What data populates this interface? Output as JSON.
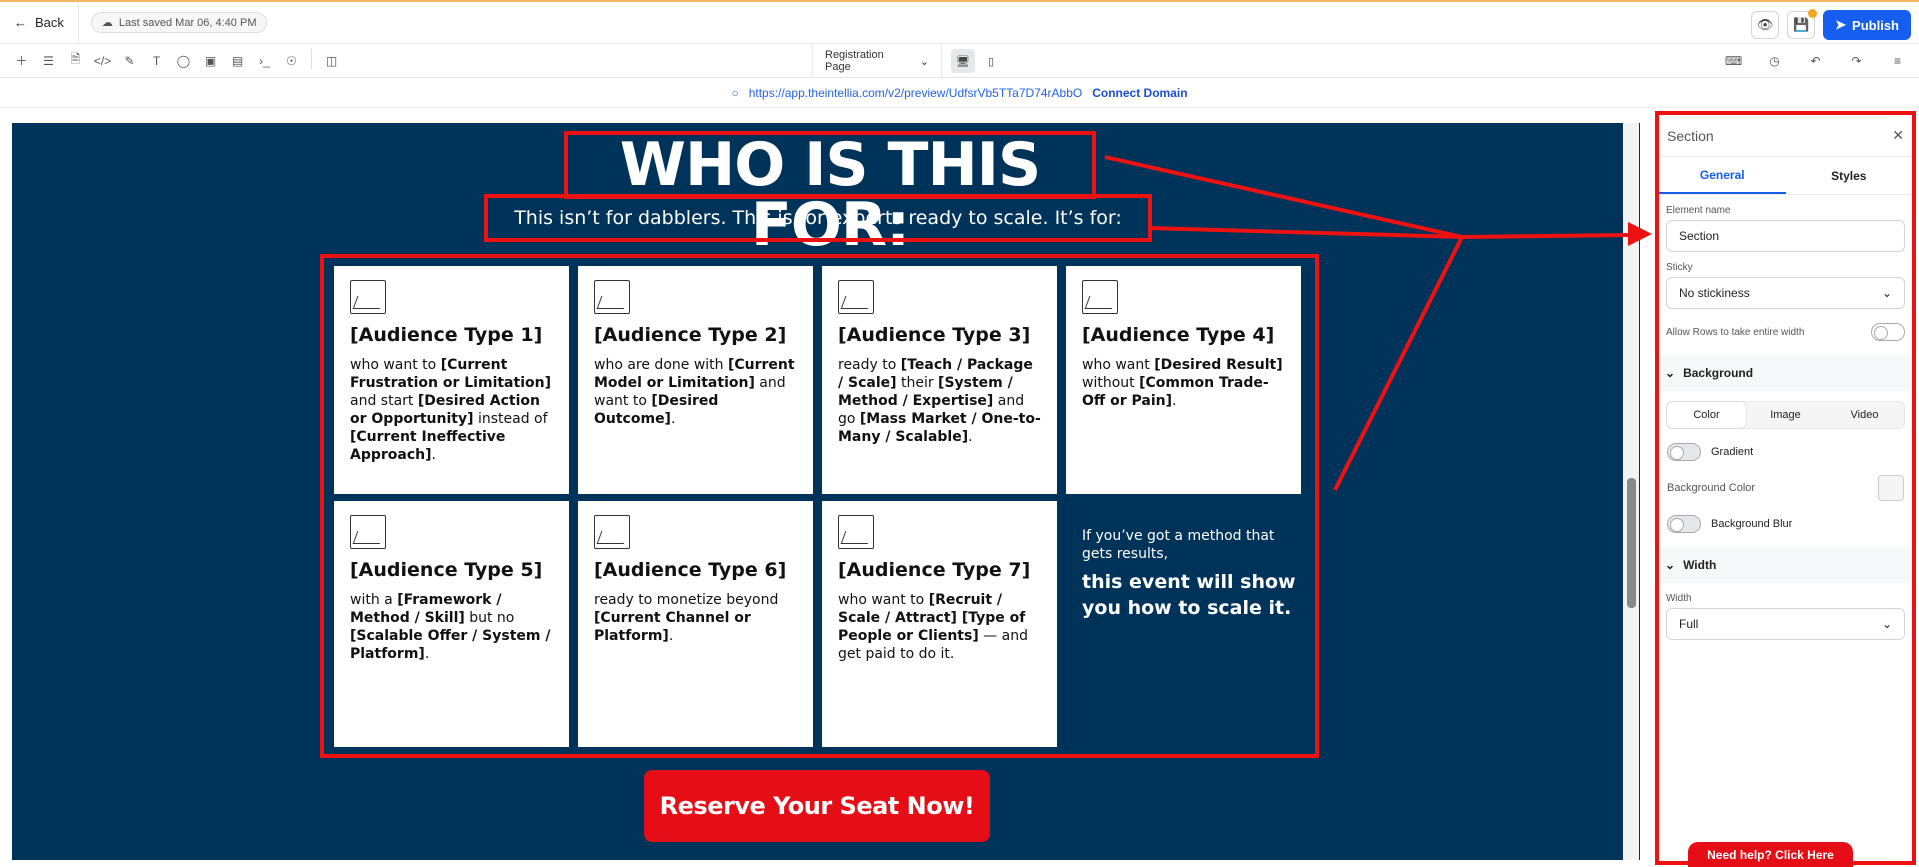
{
  "topbar": {
    "back_label": "Back",
    "saved_label": "Last saved Mar 06, 4:40 PM",
    "publish_label": "Publish"
  },
  "toolbar": {
    "page_name": "Registration Page"
  },
  "urlbar": {
    "url": "https://app.theintellia.com/v2/preview/UdfsrVb5TTa7D74rAbbO",
    "connect_label": "Connect Domain"
  },
  "canvas": {
    "title": "WHO IS THIS FOR:",
    "subtitle": "This isn’t for dabblers. This is for experts ready to scale. It’s for:",
    "cards": [
      {
        "title": "[Audience Type 1]",
        "parts": [
          [
            "who want to ",
            false
          ],
          [
            "[Current Frustration or Limitation]",
            true
          ],
          [
            " and start ",
            false
          ],
          [
            "[Desired Action or Opportunity]",
            true
          ],
          [
            " instead of ",
            false
          ],
          [
            "[Current Ineffective Approach]",
            true
          ],
          [
            ".",
            false
          ]
        ]
      },
      {
        "title": "[Audience Type 2]",
        "parts": [
          [
            "who are done with ",
            false
          ],
          [
            "[Current Model or Limitation]",
            true
          ],
          [
            " and want to ",
            false
          ],
          [
            "[Desired Outcome]",
            true
          ],
          [
            ".",
            false
          ]
        ]
      },
      {
        "title": "[Audience Type 3]",
        "parts": [
          [
            "ready to ",
            false
          ],
          [
            "[Teach / Package / Scale]",
            true
          ],
          [
            " their ",
            false
          ],
          [
            "[System / Method / Expertise]",
            true
          ],
          [
            " and go ",
            false
          ],
          [
            "[Mass Market / One-to-Many / Scalable]",
            true
          ],
          [
            ".",
            false
          ]
        ]
      },
      {
        "title": "[Audience Type 4]",
        "parts": [
          [
            "who want ",
            false
          ],
          [
            "[Desired Result]",
            true
          ],
          [
            " without ",
            false
          ],
          [
            "[Common Trade-Off or Pain]",
            true
          ],
          [
            ".",
            false
          ]
        ]
      },
      {
        "title": "[Audience Type 5]",
        "parts": [
          [
            "with a ",
            false
          ],
          [
            "[Framework / Method / Skill]",
            true
          ],
          [
            " but no ",
            false
          ],
          [
            "[Scalable Offer / System / Platform]",
            true
          ],
          [
            ".",
            false
          ]
        ]
      },
      {
        "title": "[Audience Type 6]",
        "parts": [
          [
            "ready to monetize beyond ",
            false
          ],
          [
            "[Current Channel or Platform]",
            true
          ],
          [
            ".",
            false
          ]
        ]
      },
      {
        "title": "[Audience Type 7]",
        "parts": [
          [
            "who want to ",
            false
          ],
          [
            "[Recruit / Scale / Attract] [Type of People or Clients]",
            true
          ],
          [
            " — and get paid to do it.",
            false
          ]
        ]
      }
    ],
    "closing_small": "If you’ve got a method that gets results,",
    "closing_big": "this event will show you how to scale it.",
    "cta_label": "Reserve Your Seat Now!"
  },
  "panel": {
    "header": "Section",
    "tab_general": "General",
    "tab_styles": "Styles",
    "element_name_label": "Element name",
    "element_name_value": "Section",
    "sticky_label": "Sticky",
    "sticky_value": "No stickiness",
    "allow_rows_label": "Allow Rows to take entire width",
    "background_header": "Background",
    "bg_seg": [
      "Color",
      "Image",
      "Video"
    ],
    "gradient_label": "Gradient",
    "bg_color_label": "Background Color",
    "bg_blur_label": "Background Blur",
    "width_header": "Width",
    "width_label": "Width",
    "width_value": "Full"
  },
  "help_label": "Need help? Click Here",
  "colors": {
    "accent": "#155eef",
    "brand_red": "#e50d16",
    "canvas_bg": "#00335a",
    "annotation": "#e11111"
  }
}
